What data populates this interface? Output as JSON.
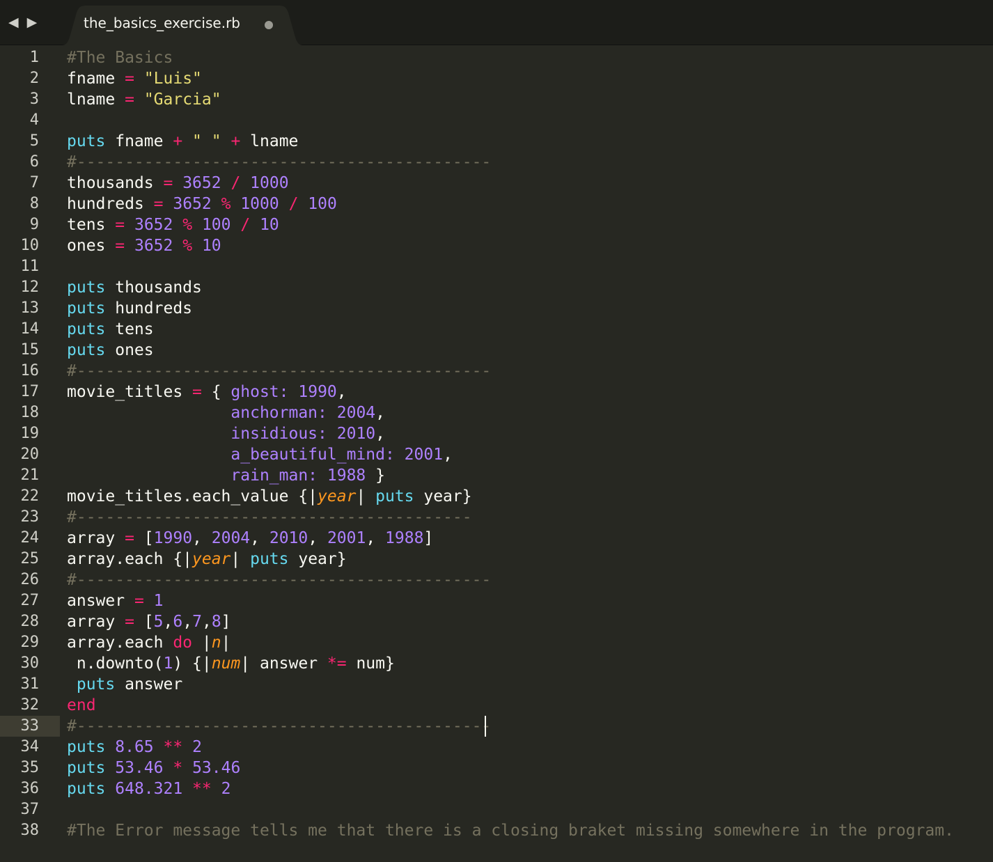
{
  "tab": {
    "title": "the_basics_exercise.rb",
    "nav_back": "◀",
    "nav_forward": "▶"
  },
  "active_line": 33,
  "line_numbers": [
    "1",
    "2",
    "3",
    "4",
    "5",
    "6",
    "7",
    "8",
    "9",
    "10",
    "11",
    "12",
    "13",
    "14",
    "15",
    "16",
    "17",
    "18",
    "19",
    "20",
    "21",
    "22",
    "23",
    "24",
    "25",
    "26",
    "27",
    "28",
    "29",
    "30",
    "31",
    "32",
    "33",
    "34",
    "35",
    "36",
    "37",
    "38"
  ],
  "code_lines": [
    [
      {
        "t": "#The Basics",
        "c": "c"
      }
    ],
    [
      {
        "t": "fname "
      },
      {
        "t": "=",
        "c": "o"
      },
      {
        "t": " "
      },
      {
        "t": "\"Luis\"",
        "c": "s"
      }
    ],
    [
      {
        "t": "lname "
      },
      {
        "t": "=",
        "c": "o"
      },
      {
        "t": " "
      },
      {
        "t": "\"Garcia\"",
        "c": "s"
      }
    ],
    [],
    [
      {
        "t": "puts",
        "c": "k"
      },
      {
        "t": " fname "
      },
      {
        "t": "+",
        "c": "o"
      },
      {
        "t": " "
      },
      {
        "t": "\" \"",
        "c": "s"
      },
      {
        "t": " "
      },
      {
        "t": "+",
        "c": "o"
      },
      {
        "t": " lname"
      }
    ],
    [
      {
        "t": "#-------------------------------------------",
        "c": "dash"
      }
    ],
    [
      {
        "t": "thousands "
      },
      {
        "t": "=",
        "c": "o"
      },
      {
        "t": " "
      },
      {
        "t": "3652",
        "c": "n"
      },
      {
        "t": " "
      },
      {
        "t": "/",
        "c": "o"
      },
      {
        "t": " "
      },
      {
        "t": "1000",
        "c": "n"
      }
    ],
    [
      {
        "t": "hundreds "
      },
      {
        "t": "=",
        "c": "o"
      },
      {
        "t": " "
      },
      {
        "t": "3652",
        "c": "n"
      },
      {
        "t": " "
      },
      {
        "t": "%",
        "c": "o"
      },
      {
        "t": " "
      },
      {
        "t": "1000",
        "c": "n"
      },
      {
        "t": " "
      },
      {
        "t": "/",
        "c": "o"
      },
      {
        "t": " "
      },
      {
        "t": "100",
        "c": "n"
      }
    ],
    [
      {
        "t": "tens "
      },
      {
        "t": "=",
        "c": "o"
      },
      {
        "t": " "
      },
      {
        "t": "3652",
        "c": "n"
      },
      {
        "t": " "
      },
      {
        "t": "%",
        "c": "o"
      },
      {
        "t": " "
      },
      {
        "t": "100",
        "c": "n"
      },
      {
        "t": " "
      },
      {
        "t": "/",
        "c": "o"
      },
      {
        "t": " "
      },
      {
        "t": "10",
        "c": "n"
      }
    ],
    [
      {
        "t": "ones "
      },
      {
        "t": "=",
        "c": "o"
      },
      {
        "t": " "
      },
      {
        "t": "3652",
        "c": "n"
      },
      {
        "t": " "
      },
      {
        "t": "%",
        "c": "o"
      },
      {
        "t": " "
      },
      {
        "t": "10",
        "c": "n"
      }
    ],
    [],
    [
      {
        "t": "puts",
        "c": "k"
      },
      {
        "t": " thousands"
      }
    ],
    [
      {
        "t": "puts",
        "c": "k"
      },
      {
        "t": " hundreds"
      }
    ],
    [
      {
        "t": "puts",
        "c": "k"
      },
      {
        "t": " tens"
      }
    ],
    [
      {
        "t": "puts",
        "c": "k"
      },
      {
        "t": " ones"
      }
    ],
    [
      {
        "t": "#-------------------------------------------",
        "c": "dash"
      }
    ],
    [
      {
        "t": "movie_titles "
      },
      {
        "t": "=",
        "c": "o"
      },
      {
        "t": " { "
      },
      {
        "t": "ghost:",
        "c": "n"
      },
      {
        "t": " "
      },
      {
        "t": "1990",
        "c": "n"
      },
      {
        "t": ","
      }
    ],
    [
      {
        "t": "                 "
      },
      {
        "t": "anchorman:",
        "c": "n"
      },
      {
        "t": " "
      },
      {
        "t": "2004",
        "c": "n"
      },
      {
        "t": ","
      }
    ],
    [
      {
        "t": "                 "
      },
      {
        "t": "insidious:",
        "c": "n"
      },
      {
        "t": " "
      },
      {
        "t": "2010",
        "c": "n"
      },
      {
        "t": ","
      }
    ],
    [
      {
        "t": "                 "
      },
      {
        "t": "a_beautiful_mind:",
        "c": "n"
      },
      {
        "t": " "
      },
      {
        "t": "2001",
        "c": "n"
      },
      {
        "t": ","
      }
    ],
    [
      {
        "t": "                 "
      },
      {
        "t": "rain_man:",
        "c": "n"
      },
      {
        "t": " "
      },
      {
        "t": "1988",
        "c": "n"
      },
      {
        "t": " }"
      }
    ],
    [
      {
        "t": "movie_titles.each_value {|"
      },
      {
        "t": "year",
        "c": "p"
      },
      {
        "t": "| "
      },
      {
        "t": "puts",
        "c": "k"
      },
      {
        "t": " year}"
      }
    ],
    [
      {
        "t": "#-----------------------------------------",
        "c": "dash"
      }
    ],
    [
      {
        "t": "array "
      },
      {
        "t": "=",
        "c": "o"
      },
      {
        "t": " ["
      },
      {
        "t": "1990",
        "c": "n"
      },
      {
        "t": ", "
      },
      {
        "t": "2004",
        "c": "n"
      },
      {
        "t": ", "
      },
      {
        "t": "2010",
        "c": "n"
      },
      {
        "t": ", "
      },
      {
        "t": "2001",
        "c": "n"
      },
      {
        "t": ", "
      },
      {
        "t": "1988",
        "c": "n"
      },
      {
        "t": "]"
      }
    ],
    [
      {
        "t": "array.each {|"
      },
      {
        "t": "year",
        "c": "p"
      },
      {
        "t": "| "
      },
      {
        "t": "puts",
        "c": "k"
      },
      {
        "t": " year}"
      }
    ],
    [
      {
        "t": "#-------------------------------------------",
        "c": "dash"
      }
    ],
    [
      {
        "t": "answer "
      },
      {
        "t": "=",
        "c": "o"
      },
      {
        "t": " "
      },
      {
        "t": "1",
        "c": "n"
      }
    ],
    [
      {
        "t": "array "
      },
      {
        "t": "=",
        "c": "o"
      },
      {
        "t": " ["
      },
      {
        "t": "5",
        "c": "n"
      },
      {
        "t": ","
      },
      {
        "t": "6",
        "c": "n"
      },
      {
        "t": ","
      },
      {
        "t": "7",
        "c": "n"
      },
      {
        "t": ","
      },
      {
        "t": "8",
        "c": "n"
      },
      {
        "t": "]"
      }
    ],
    [
      {
        "t": "array.each "
      },
      {
        "t": "do",
        "c": "kw"
      },
      {
        "t": " |"
      },
      {
        "t": "n",
        "c": "p"
      },
      {
        "t": "|"
      }
    ],
    [
      {
        "t": " n.downto("
      },
      {
        "t": "1",
        "c": "n"
      },
      {
        "t": ") {|"
      },
      {
        "t": "num",
        "c": "p"
      },
      {
        "t": "| answer "
      },
      {
        "t": "*=",
        "c": "o"
      },
      {
        "t": " num}"
      }
    ],
    [
      {
        "t": " "
      },
      {
        "t": "puts",
        "c": "k"
      },
      {
        "t": " answer"
      }
    ],
    [
      {
        "t": "end",
        "c": "kw"
      }
    ],
    [
      {
        "t": "#-------------------------------------------",
        "c": "dash"
      }
    ],
    [
      {
        "t": "puts",
        "c": "k"
      },
      {
        "t": " "
      },
      {
        "t": "8.65",
        "c": "n"
      },
      {
        "t": " "
      },
      {
        "t": "**",
        "c": "o"
      },
      {
        "t": " "
      },
      {
        "t": "2",
        "c": "n"
      }
    ],
    [
      {
        "t": "puts",
        "c": "k"
      },
      {
        "t": " "
      },
      {
        "t": "53.46",
        "c": "n"
      },
      {
        "t": " "
      },
      {
        "t": "*",
        "c": "o"
      },
      {
        "t": " "
      },
      {
        "t": "53.46",
        "c": "n"
      }
    ],
    [
      {
        "t": "puts",
        "c": "k"
      },
      {
        "t": " "
      },
      {
        "t": "648.321",
        "c": "n"
      },
      {
        "t": " "
      },
      {
        "t": "**",
        "c": "o"
      },
      {
        "t": " "
      },
      {
        "t": "2",
        "c": "n"
      }
    ],
    [],
    [
      {
        "t": "#The Error message tells me that there is a closing braket missing somewhere in the program.",
        "c": "c"
      }
    ]
  ]
}
